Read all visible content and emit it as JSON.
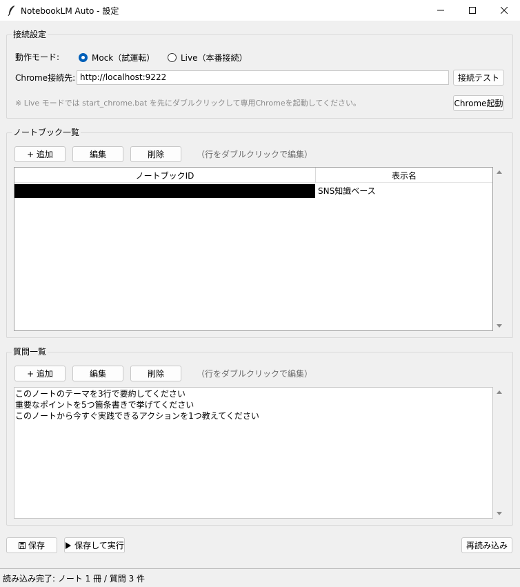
{
  "window": {
    "title": "NotebookLM Auto - 設定",
    "icon": "feather-icon"
  },
  "connection": {
    "group_title": "接続設定",
    "mode_label": "動作モード:",
    "mode_options": [
      {
        "label": "Mock（試運転）",
        "selected": true
      },
      {
        "label": "Live（本番接続）",
        "selected": false
      }
    ],
    "chrome_label": "Chrome接続先:",
    "chrome_url": "http://localhost:9222",
    "test_button": "接続テスト",
    "hint": "※ Live モードでは start_chrome.bat を先にダブルクリックして専用Chromeを起動してください。",
    "launch_button": "Chrome起動"
  },
  "notebooks": {
    "group_title": "ノートブック一覧",
    "add_button": "+ 追加",
    "edit_button": "編集",
    "delete_button": "削除",
    "hint": "（行をダブルクリックで編集）",
    "columns": [
      "ノートブックID",
      "表示名"
    ],
    "rows": [
      {
        "id": "",
        "name": "SNS知識ベース"
      }
    ]
  },
  "questions": {
    "group_title": "質問一覧",
    "add_button": "+ 追加",
    "edit_button": "編集",
    "delete_button": "削除",
    "hint": "（行をダブルクリックで編集）",
    "lines": [
      "このノートのテーマを3行で要約してください",
      "重要なポイントを5つ箇条書きで挙げてください",
      "このノートから今すぐ実践できるアクションを1つ教えてください"
    ]
  },
  "footer": {
    "save_button": "保存",
    "save_run_button": "保存して実行",
    "reload_button": "再読み込み"
  },
  "status": {
    "text": "読み込み完了: ノート 1 冊 / 質問 3 件"
  },
  "colors": {
    "accent": "#005fb8",
    "background": "#f0f0f0"
  }
}
